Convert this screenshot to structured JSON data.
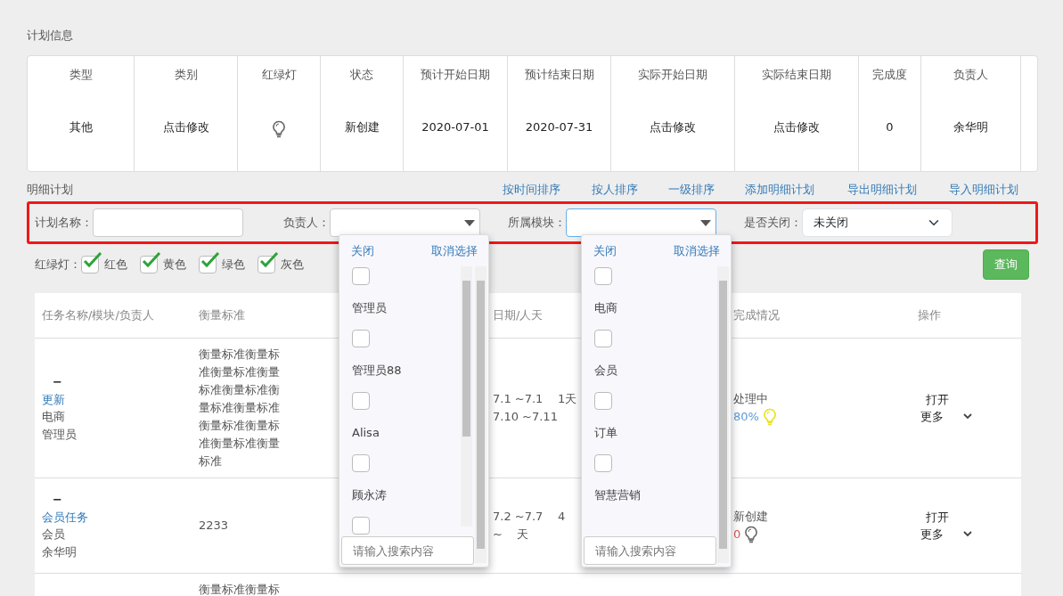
{
  "plan_info": {
    "title": "计划信息",
    "columns": [
      {
        "heading": "类型",
        "value": "其他",
        "kind": "text"
      },
      {
        "heading": "类别",
        "value": "点击修改",
        "kind": "text"
      },
      {
        "heading": "红绿灯",
        "kind": "bulb",
        "color": "#666666"
      },
      {
        "heading": "状态",
        "value": "新创建",
        "kind": "text"
      },
      {
        "heading": "预计开始日期",
        "value": "2020-07-01",
        "kind": "text"
      },
      {
        "heading": "预计结束日期",
        "value": "2020-07-31",
        "kind": "text"
      },
      {
        "heading": "实际开始日期",
        "value": "点击修改",
        "kind": "text"
      },
      {
        "heading": "实际结束日期",
        "value": "点击修改",
        "kind": "text"
      },
      {
        "heading": "完成度",
        "value": "0",
        "kind": "text"
      },
      {
        "heading": "负责人",
        "value": "余华明",
        "kind": "text"
      }
    ]
  },
  "detail": {
    "title": "明细计划",
    "links": [
      "按时间排序",
      "按人排序",
      "一级排序",
      "添加明细计划",
      "导出明细计划",
      "导入明细计划"
    ],
    "filters": [
      {
        "label": "计划名称：",
        "kind": "input"
      },
      {
        "label": "负责人：",
        "kind": "select"
      },
      {
        "label": "所属模块：",
        "kind": "select"
      },
      {
        "label": "是否关闭：",
        "kind": "native",
        "value": "未关闭"
      }
    ],
    "light_filter": {
      "label": "红绿灯：",
      "options": [
        {
          "label": "红色",
          "checked": true
        },
        {
          "label": "黄色",
          "checked": true
        },
        {
          "label": "绿色",
          "checked": true
        },
        {
          "label": "灰色",
          "checked": true
        }
      ]
    },
    "query_button": "查询"
  },
  "table": {
    "columns": [
      "任务名称/模块/负责人",
      "衡量标准",
      "日期/人天",
      "完成情况",
      "操作"
    ],
    "rows": [
      {
        "toggle": "−",
        "name": "更新",
        "module": "电商",
        "owner": "管理员",
        "standard": "衡量标准衡量标准衡量标准衡量标准衡量标准衡量标准衡量标准衡量标准衡量标准衡量标准衡量标准",
        "dates": [
          "7.1 ~7.1    1天",
          "7.10 ~7.11"
        ],
        "status": "处理中",
        "progress": {
          "text": "80%",
          "color": "#5b9bd5"
        },
        "bulb": {
          "color": "#e8e21a"
        },
        "actions": [
          "打开",
          "更多"
        ]
      },
      {
        "toggle": "−",
        "name": "会员任务",
        "module": "会员",
        "owner": "余华明",
        "standard": "2233",
        "dates": [
          "7.2 ~7.7    4",
          "~    天"
        ],
        "status": "新创建",
        "progress": {
          "text": "0",
          "color": "#d9534f"
        },
        "bulb": {
          "color": "#666666"
        },
        "actions": [
          "打开",
          "更多"
        ]
      },
      {
        "standard": "衡量标准衡量标"
      }
    ]
  },
  "dropdowns": [
    {
      "open": true,
      "close": "关闭",
      "clear": "取消选择",
      "items": [
        {
          "label": "管理员",
          "checked": false
        },
        {
          "label": "管理员88",
          "checked": false
        },
        {
          "label": "Alisa",
          "checked": false
        },
        {
          "label": "顾永涛",
          "checked": false
        },
        {
          "checked": false
        }
      ],
      "search_placeholder": "请输入搜索内容"
    },
    {
      "open": true,
      "close": "关闭",
      "clear": "取消选择",
      "items": [
        {
          "label": "电商",
          "checked": false
        },
        {
          "label": "会员",
          "checked": false
        },
        {
          "label": "订单",
          "checked": false
        },
        {
          "label": "智慧营销",
          "checked": false
        }
      ],
      "search_placeholder": "请输入搜索内容"
    }
  ]
}
